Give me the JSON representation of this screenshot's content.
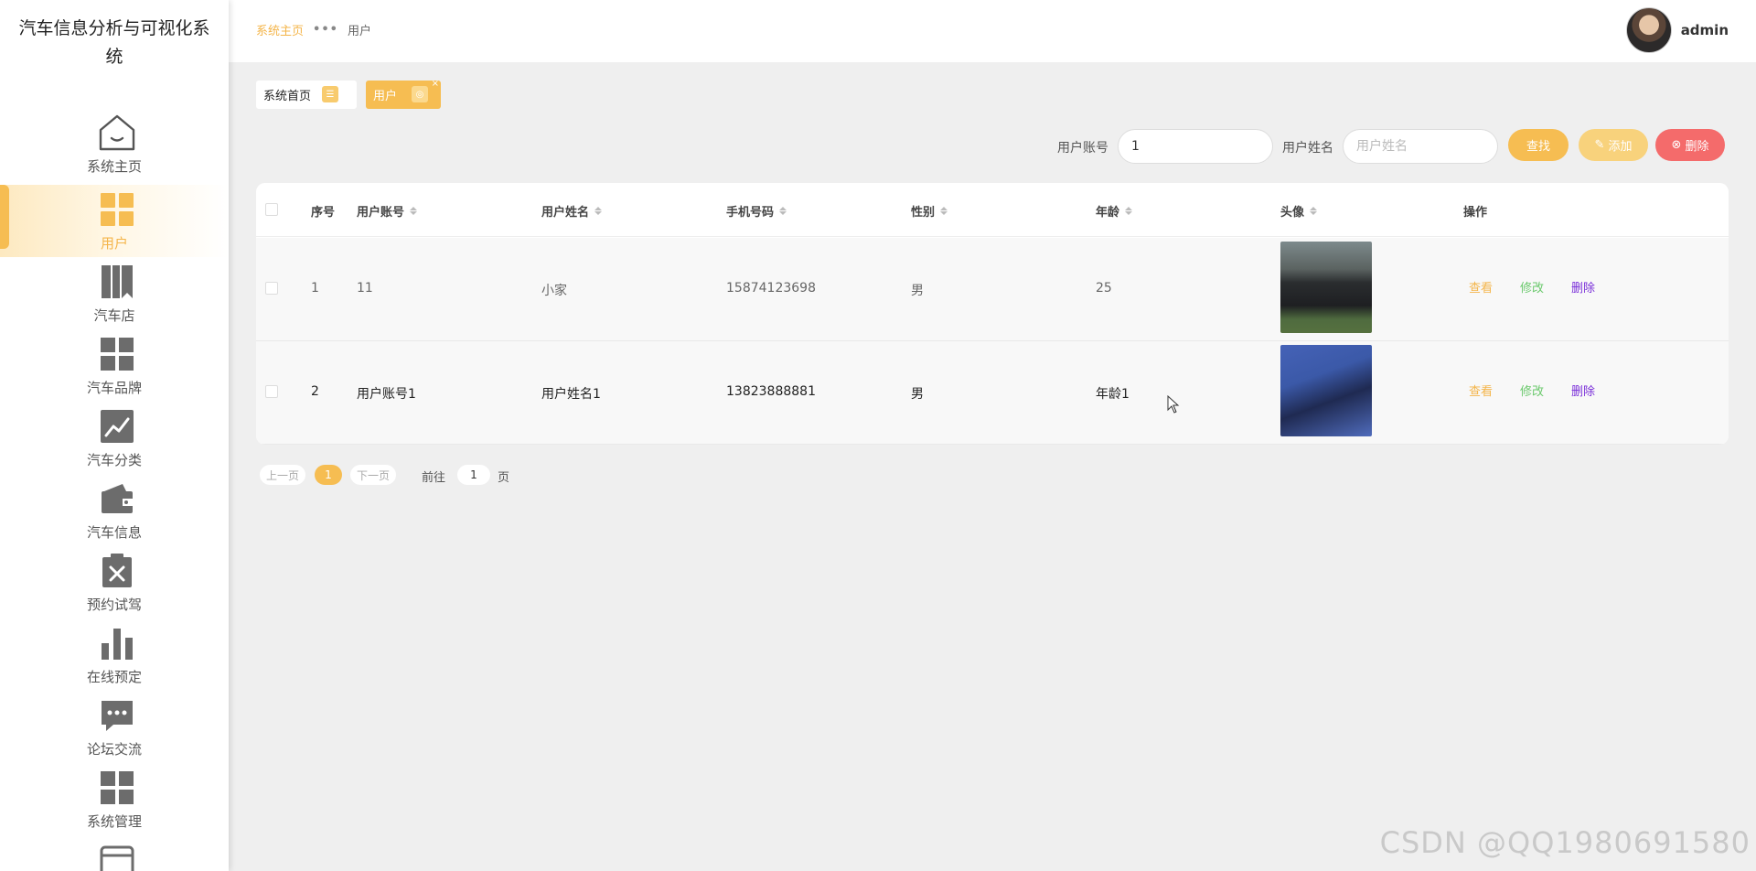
{
  "app": {
    "title": "汽车信息分析与可视化系统"
  },
  "sidebar": {
    "items": [
      {
        "label": "系统主页",
        "icon": "home-icon"
      },
      {
        "label": "用户",
        "icon": "grid-icon"
      },
      {
        "label": "汽车店",
        "icon": "books-icon"
      },
      {
        "label": "汽车品牌",
        "icon": "grid-icon"
      },
      {
        "label": "汽车分类",
        "icon": "trend-chart-icon"
      },
      {
        "label": "汽车信息",
        "icon": "wallet-icon"
      },
      {
        "label": "预约试驾",
        "icon": "clipboard-x-icon"
      },
      {
        "label": "在线预定",
        "icon": "bar-chart-icon"
      },
      {
        "label": "论坛交流",
        "icon": "chat-icon"
      },
      {
        "label": "系统管理",
        "icon": "grid-icon"
      }
    ],
    "active": "用户"
  },
  "header": {
    "breadcrumb_home": "系统主页",
    "breadcrumb_sep": "•••",
    "breadcrumb_current": "用户",
    "username": "admin"
  },
  "tabs": [
    {
      "label": "系统首页"
    },
    {
      "label": "用户",
      "close": "×"
    }
  ],
  "search": {
    "account_label": "用户账号",
    "account_value": "1",
    "name_label": "用户姓名",
    "name_placeholder": "用户姓名",
    "find_label": "查找",
    "add_label": "添加",
    "delete_label": "删除"
  },
  "table": {
    "headers": {
      "index": "序号",
      "account": "用户账号",
      "name": "用户姓名",
      "phone": "手机号码",
      "gender": "性别",
      "age": "年龄",
      "avatar": "头像",
      "actions": "操作"
    },
    "rows": [
      {
        "index": "1",
        "account": "11",
        "name": "小家",
        "phone": "15874123698",
        "gender": "男",
        "age": "25"
      },
      {
        "index": "2",
        "account": "用户账号1",
        "name": "用户姓名1",
        "phone": "13823888881",
        "gender": "男",
        "age": "年龄1"
      }
    ],
    "actions": {
      "view": "查看",
      "edit": "修改",
      "delete": "删除"
    }
  },
  "pager": {
    "prev": "上一页",
    "current": "1",
    "next": "下一页",
    "goto": "前往",
    "goto_value": "1",
    "page_unit": "页"
  },
  "watermark": "CSDN @QQ1980691580",
  "colors": {
    "accent": "#f6bd52",
    "danger": "#f46b6b",
    "edit": "#6ac96c",
    "delete_link": "#7a2fd9"
  }
}
